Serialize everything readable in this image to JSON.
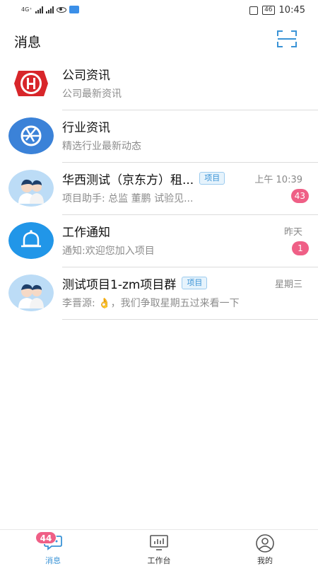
{
  "status_bar": {
    "network_label": "4G⁺",
    "time": "10:45",
    "battery": "46"
  },
  "header": {
    "title": "消息"
  },
  "conversations": [
    {
      "title": "公司资讯",
      "subtitle": "公司最新资讯",
      "tag": "",
      "time": "",
      "badge": ""
    },
    {
      "title": "行业资讯",
      "subtitle": "精选行业最新动态",
      "tag": "",
      "time": "",
      "badge": ""
    },
    {
      "title": "华西测试（京东方）租...",
      "subtitle": "项目助手: 总监 董鹏 试验见...",
      "tag": "项目",
      "time": "上午 10:39",
      "badge": "43"
    },
    {
      "title": "工作通知",
      "subtitle": "通知:欢迎您加入项目",
      "tag": "",
      "time": "昨天",
      "badge": "1"
    },
    {
      "title": "测试项目1-zm项目群",
      "subtitle": "李晋源: 👌，我们争取星期五过来看一下",
      "tag": "项目",
      "time": "星期三",
      "badge": ""
    }
  ],
  "tabbar": {
    "messages": {
      "label": "消息",
      "badge": "44"
    },
    "workbench": {
      "label": "工作台"
    },
    "mine": {
      "label": "我的"
    }
  },
  "colors": {
    "accent": "#3a93d6",
    "badge": "#ef5f86",
    "company_red": "#d8262a",
    "industry_blue": "#3b82d8",
    "notice_blue": "#2196e8"
  }
}
